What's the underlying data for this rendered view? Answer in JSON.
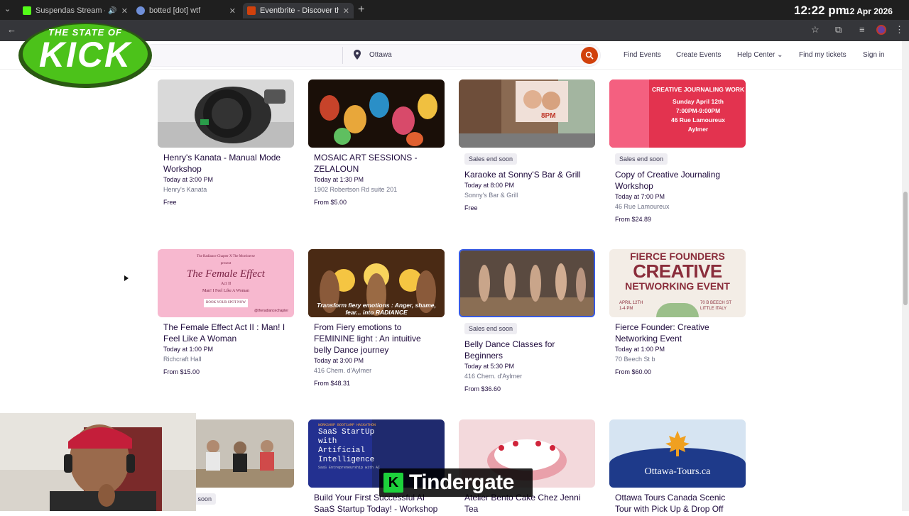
{
  "browser": {
    "tabs": [
      {
        "title": "Suspendas Stream - Watch",
        "favicon_color": "#53fc18"
      },
      {
        "title": "botted [dot] wtf",
        "favicon_color": "#6f8fd8"
      },
      {
        "title": "Eventbrite - Discover the Best E",
        "favicon_color": "#d1410c"
      }
    ],
    "clock": "12:22 pm",
    "date": "12 Apr 2026"
  },
  "overlay": {
    "logo_line1": "THE STATE OF",
    "logo_line2": "KICK",
    "subtitle_badge": "K",
    "subtitle_text": "Tindergate"
  },
  "header": {
    "location": "Ottawa",
    "nav": [
      "Find Events",
      "Create Events",
      "Help Center",
      "Find my tickets",
      "Sign in"
    ]
  },
  "events": [
    {
      "badge": "",
      "title": "Henry's Kanata - Manual Mode Workshop",
      "time": "Today at 3:00 PM",
      "venue": "Henry's Kanata",
      "price": "Free"
    },
    {
      "badge": "",
      "title": "MOSAIC ART SESSIONS - ZELALOUN",
      "time": "Today at 1:30 PM",
      "venue": "1902 Robertson Rd suite 201",
      "price": "From $5.00"
    },
    {
      "badge": "Sales end soon",
      "title": "Karaoke at Sonny'S Bar & Grill",
      "time": "Today at 8:00 PM",
      "venue": "Sonny's Bar & Grill",
      "price": "Free",
      "img_text": "8PM"
    },
    {
      "badge": "Sales end soon",
      "title": "Copy of Creative Journaling Workshop",
      "time": "Today at 7:00 PM",
      "venue": "46 Rue Lamoureux",
      "price": "From $24.89",
      "img_lines": [
        "CREATIVE JOURNALING WORK",
        "Sunday April 12th",
        "7:00PM-9:00PM",
        "46 Rue Lamoureux",
        "Aylmer"
      ]
    },
    {
      "badge": "",
      "title": "The Female Effect Act II : Man! I Feel Like A Woman",
      "time": "Today at 1:00 PM",
      "venue": "Richcraft Hall",
      "price": "From $15.00",
      "img_lines": [
        "The Radiance Chapter X The Morrinerse",
        "present",
        "The Female Effect",
        "Act II",
        "Man! I Feel Like A Woman",
        "BOOK YOUR SPOT NOW",
        "@theradiancechapter"
      ]
    },
    {
      "badge": "",
      "title": "From Fiery emotions to FEMININE light : An intuitive belly Dance journey",
      "time": "Today at 3:00 PM",
      "venue": "416 Chem. d'Aylmer",
      "price": "From $48.31",
      "img_lines": [
        "Transform fiery emotions : Anger, shame,",
        "fear... into RADIANCE"
      ]
    },
    {
      "badge": "Sales end soon",
      "title": "Belly Dance Classes for Beginners",
      "time": "Today at 5:30 PM",
      "venue": "416 Chem. d'Aylmer",
      "price": "From $36.60"
    },
    {
      "badge": "",
      "title": "Fierce Founder: Creative Networking Event",
      "time": "Today at 1:00 PM",
      "venue": "70 Beech St b",
      "price": "From $60.00",
      "img_lines": [
        "FIERCE FOUNDERS",
        "CREATIVE",
        "NETWORKING EVENT",
        "APRIL 12TH",
        "1-4 PM",
        "70 B BEECH ST",
        "LITTLE ITALY"
      ]
    },
    {
      "badge": "Sales end soon",
      "title": "",
      "time": "",
      "venue": "",
      "price": ""
    },
    {
      "badge": "",
      "title": "Build Your First Successful AI SaaS Startup Today! - Workshop",
      "time": "",
      "venue": "",
      "price": "",
      "img_lines": [
        "WORKSHOP BOOTCAMP HACKATHON",
        "SaaS StartUp",
        "with",
        "Artificial",
        "Intelligence",
        "SaaS Entrepreneurship with AI"
      ]
    },
    {
      "badge": "",
      "title": "Atelier Bento Cake Chez Jenni Tea",
      "time": "",
      "venue": "",
      "price": ""
    },
    {
      "badge": "",
      "title": "Ottawa Tours Canada Scenic Tour with Pick Up & Drop Off",
      "time": "",
      "venue": "",
      "price": "",
      "img_lines": [
        "Ottawa-Tours.ca"
      ]
    }
  ]
}
